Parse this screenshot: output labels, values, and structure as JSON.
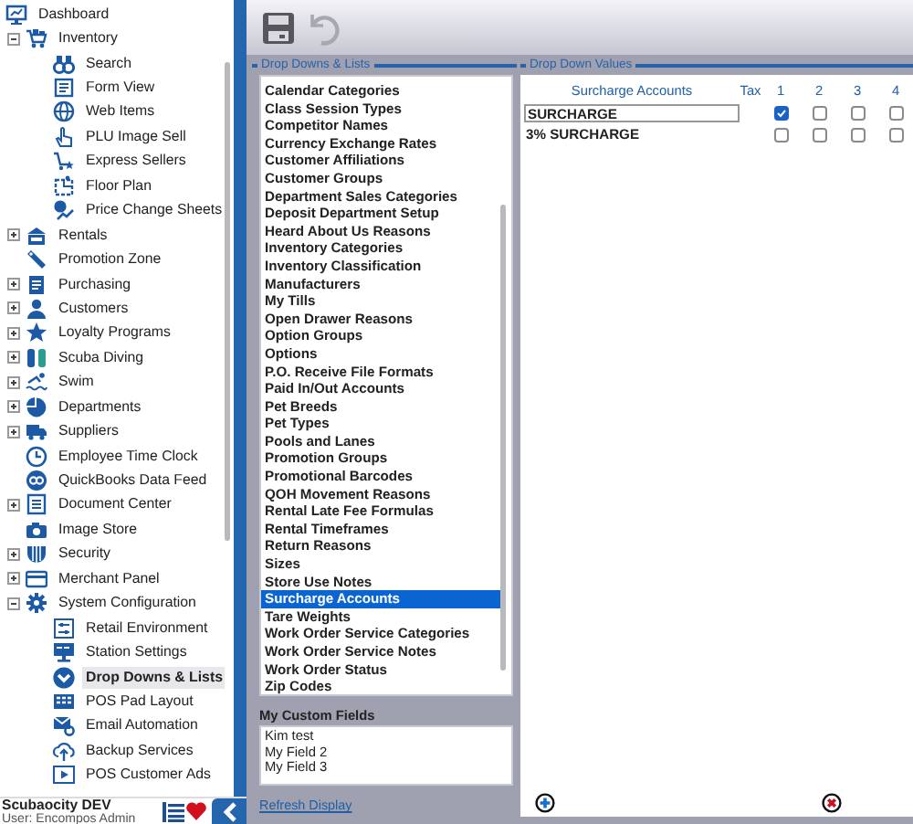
{
  "sidebar": {
    "items": [
      {
        "label": "Dashboard",
        "selected": false,
        "children": [
          {
            "label": "Inventory",
            "selected": false,
            "expanded": true,
            "children": [
              {
                "label": "Search",
                "selected": false
              },
              {
                "label": "Form View",
                "selected": false
              },
              {
                "label": "Web Items",
                "selected": false
              },
              {
                "label": "PLU Image Sell",
                "selected": false
              },
              {
                "label": "Express Sellers",
                "selected": false
              },
              {
                "label": "Floor Plan",
                "selected": false
              },
              {
                "label": "Price Change Sheets",
                "selected": false
              }
            ]
          },
          {
            "label": "Rentals",
            "selected": false,
            "expanded": false
          },
          {
            "label": "Promotion Zone",
            "selected": false
          },
          {
            "label": "Purchasing",
            "selected": false,
            "expanded": false
          },
          {
            "label": "Customers",
            "selected": false,
            "expanded": false
          },
          {
            "label": "Loyalty Programs",
            "selected": false,
            "expanded": false
          },
          {
            "label": "Scuba Diving",
            "selected": false,
            "expanded": false
          },
          {
            "label": "Swim",
            "selected": false,
            "expanded": false
          },
          {
            "label": "Departments",
            "selected": false,
            "expanded": false
          },
          {
            "label": "Suppliers",
            "selected": false,
            "expanded": false
          },
          {
            "label": "Employee Time Clock",
            "selected": false
          },
          {
            "label": "QuickBooks Data Feed",
            "selected": false
          },
          {
            "label": "Document Center",
            "selected": false,
            "expanded": false
          },
          {
            "label": "Image Store",
            "selected": false
          },
          {
            "label": "Security",
            "selected": false,
            "expanded": false
          },
          {
            "label": "Merchant Panel",
            "selected": false,
            "expanded": false
          },
          {
            "label": "System Configuration",
            "selected": false,
            "expanded": true,
            "children": [
              {
                "label": "Retail Environment",
                "selected": false
              },
              {
                "label": "Station Settings",
                "selected": false
              },
              {
                "label": "Drop Downs & Lists",
                "selected": true
              },
              {
                "label": "POS Pad Layout",
                "selected": false
              },
              {
                "label": "Email Automation",
                "selected": false
              },
              {
                "label": "Backup Services",
                "selected": false
              },
              {
                "label": "POS Customer Ads",
                "selected": false
              }
            ]
          }
        ]
      }
    ]
  },
  "footer": {
    "title": "Scubaocity DEV",
    "user": "User: Encompos Admin"
  },
  "lists_panel": {
    "title": "Drop Downs & Lists",
    "items": [
      {
        "label": "Calendar Categories",
        "selected": false
      },
      {
        "label": "Class Session Types",
        "selected": false
      },
      {
        "label": "Competitor Names",
        "selected": false
      },
      {
        "label": "Currency Exchange Rates",
        "selected": false
      },
      {
        "label": "Customer Affiliations",
        "selected": false
      },
      {
        "label": "Customer Groups",
        "selected": false
      },
      {
        "label": "Department Sales Categories",
        "selected": false
      },
      {
        "label": "Deposit Department Setup",
        "selected": false
      },
      {
        "label": "Heard About Us Reasons",
        "selected": false
      },
      {
        "label": "Inventory Categories",
        "selected": false
      },
      {
        "label": "Inventory Classification",
        "selected": false
      },
      {
        "label": "Manufacturers",
        "selected": false
      },
      {
        "label": "My Tills",
        "selected": false
      },
      {
        "label": "Open Drawer Reasons",
        "selected": false
      },
      {
        "label": "Option Groups",
        "selected": false
      },
      {
        "label": "Options",
        "selected": false
      },
      {
        "label": "P.O. Receive File Formats",
        "selected": false
      },
      {
        "label": "Paid In/Out Accounts",
        "selected": false
      },
      {
        "label": "Pet Breeds",
        "selected": false
      },
      {
        "label": "Pet Types",
        "selected": false
      },
      {
        "label": "Pools and Lanes",
        "selected": false
      },
      {
        "label": "Promotion Groups",
        "selected": false
      },
      {
        "label": "Promotional Barcodes",
        "selected": false
      },
      {
        "label": "QOH Movement Reasons",
        "selected": false
      },
      {
        "label": "Rental Late Fee Formulas",
        "selected": false
      },
      {
        "label": "Rental Timeframes",
        "selected": false
      },
      {
        "label": "Return Reasons",
        "selected": false
      },
      {
        "label": "Sizes",
        "selected": false
      },
      {
        "label": "Store Use Notes",
        "selected": false
      },
      {
        "label": "Surcharge Accounts",
        "selected": true
      },
      {
        "label": "Tare Weights",
        "selected": false
      },
      {
        "label": "Work Order Service Categories",
        "selected": false
      },
      {
        "label": "Work Order Service Notes",
        "selected": false
      },
      {
        "label": "Work Order Status",
        "selected": false
      },
      {
        "label": "Zip Codes",
        "selected": false
      }
    ],
    "custom_fields": {
      "label": "My Custom Fields",
      "items": [
        "Kim test",
        "My Field 2",
        "My Field 3"
      ]
    },
    "refresh_link": "Refresh Display"
  },
  "values_panel": {
    "title": "Drop Down Values",
    "columns": [
      "Surcharge Accounts",
      "Tax",
      "1",
      "2",
      "3",
      "4"
    ],
    "rows": [
      {
        "name": "SURCHARGE",
        "editing": true,
        "checks": [
          true,
          false,
          false,
          false
        ]
      },
      {
        "name": "3% SURCHARGE",
        "editing": false,
        "checks": [
          false,
          false,
          false,
          false
        ]
      }
    ]
  }
}
